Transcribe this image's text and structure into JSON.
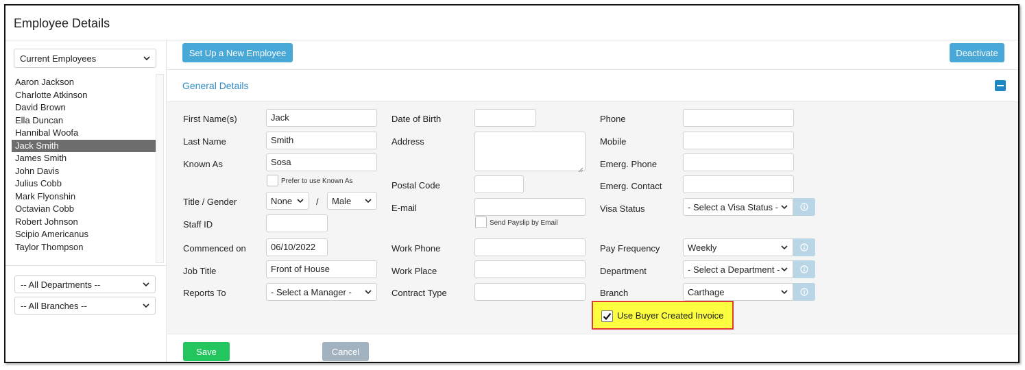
{
  "page": {
    "title": "Employee Details"
  },
  "sidebar": {
    "filter_selected": "Current Employees",
    "employees": [
      "Aaron Jackson",
      "Charlotte Atkinson",
      "David Brown",
      "Ella Duncan",
      "Hannibal Woofa",
      "Jack Smith",
      "James Smith",
      "John Davis",
      "Julius Cobb",
      "Mark Flyonshin",
      "Octavian Cobb",
      "Robert Johnson",
      "Scipio Americanus",
      "Taylor Thompson"
    ],
    "selected_employee": "Jack Smith",
    "department_selected": "-- All Departments --",
    "branch_selected": "-- All Branches --"
  },
  "toolbar": {
    "new_employee_label": "Set Up a New Employee",
    "deactivate_label": "Deactivate"
  },
  "section": {
    "title": "General Details"
  },
  "form": {
    "first_name": {
      "label": "First Name(s)",
      "value": "Jack"
    },
    "last_name": {
      "label": "Last Name",
      "value": "Smith"
    },
    "known_as": {
      "label": "Known As",
      "value": "Sosa"
    },
    "prefer_known_as": {
      "label": "Prefer to use Known As",
      "checked": false
    },
    "title_gender": {
      "label": "Title / Gender",
      "title_value": "None",
      "separator": "/",
      "gender_value": "Male"
    },
    "staff_id": {
      "label": "Staff ID",
      "value": ""
    },
    "commenced_on": {
      "label": "Commenced on",
      "value": "06/10/2022"
    },
    "job_title": {
      "label": "Job Title",
      "value": "Front of House"
    },
    "reports_to": {
      "label": "Reports To",
      "value": "- Select a Manager -"
    },
    "date_of_birth": {
      "label": "Date of Birth",
      "value": ""
    },
    "address": {
      "label": "Address",
      "value": ""
    },
    "postal_code": {
      "label": "Postal Code",
      "value": ""
    },
    "email": {
      "label": "E-mail",
      "value": ""
    },
    "send_payslip": {
      "label": "Send Payslip by Email",
      "checked": false
    },
    "work_phone": {
      "label": "Work Phone",
      "value": ""
    },
    "work_place": {
      "label": "Work Place",
      "value": ""
    },
    "contract_type": {
      "label": "Contract Type",
      "value": ""
    },
    "phone": {
      "label": "Phone",
      "value": ""
    },
    "mobile": {
      "label": "Mobile",
      "value": ""
    },
    "emerg_phone": {
      "label": "Emerg. Phone",
      "value": ""
    },
    "emerg_contact": {
      "label": "Emerg. Contact",
      "value": ""
    },
    "visa_status": {
      "label": "Visa Status",
      "value": "- Select a Visa Status -"
    },
    "pay_frequency": {
      "label": "Pay Frequency",
      "value": "Weekly"
    },
    "department": {
      "label": "Department",
      "value": "- Select a Department -"
    },
    "branch": {
      "label": "Branch",
      "value": "Carthage"
    },
    "buyer_invoice": {
      "label": "Use Buyer Created Invoice",
      "checked": true
    }
  },
  "actions": {
    "save_label": "Save",
    "cancel_label": "Cancel"
  },
  "colors": {
    "accent_blue": "#48a9d8",
    "section_title": "#2f8cc4",
    "save_green": "#22c55e",
    "cancel_gray": "#a2b3bf",
    "highlight_yellow": "#fdfd3f",
    "highlight_border": "#e03b2f",
    "selected_row": "#6d6d6d"
  }
}
